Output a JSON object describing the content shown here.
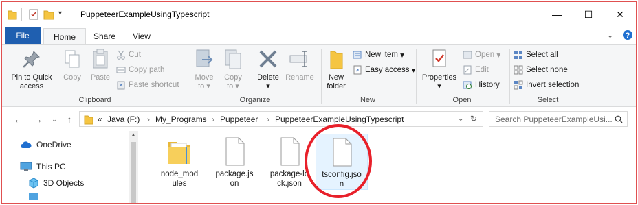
{
  "window": {
    "title": "PuppeteerExampleUsingTypescript",
    "minimize": "—",
    "maximize": "☐",
    "close": "✕"
  },
  "ribbon_tabs": {
    "file": "File",
    "home": "Home",
    "share": "Share",
    "view": "View"
  },
  "clipboard": {
    "pin": "Pin to Quick access",
    "pin_line1": "Pin to Quick",
    "pin_line2": "access",
    "copy": "Copy",
    "paste": "Paste",
    "cut": "Cut",
    "copy_path": "Copy path",
    "paste_shortcut": "Paste shortcut",
    "label": "Clipboard"
  },
  "organize": {
    "move_to": "Move to",
    "move_line1": "Move",
    "move_line2": "to",
    "copy_to": "Copy to",
    "copy_line1": "Copy",
    "copy_line2": "to",
    "delete": "Delete",
    "rename": "Rename",
    "label": "Organize"
  },
  "new": {
    "new_folder_line1": "New",
    "new_folder_line2": "folder",
    "new_item": "New item",
    "easy_access": "Easy access",
    "label": "New"
  },
  "open": {
    "properties": "Properties",
    "open": "Open",
    "edit": "Edit",
    "history": "History",
    "label": "Open"
  },
  "select": {
    "select_all": "Select all",
    "select_none": "Select none",
    "invert": "Invert selection",
    "label": "Select"
  },
  "address": {
    "prefix": "«",
    "crumbs": [
      "Java (F:)",
      "My_Programs",
      "Puppeteer",
      "PuppeteerExampleUsingTypescript"
    ],
    "search_placeholder": "Search PuppeteerExampleUsi..."
  },
  "nav_pane": {
    "items": [
      "OneDrive",
      "This PC",
      "3D Objects"
    ]
  },
  "files": [
    {
      "name": "node_modules",
      "line1": "node_mod",
      "line2": "ules",
      "type": "folder",
      "selected": false
    },
    {
      "name": "package.json",
      "line1": "package.js",
      "line2": "on",
      "type": "file",
      "selected": false
    },
    {
      "name": "package-lock.json",
      "line1": "package-lo",
      "line2": "ck.json",
      "type": "file",
      "selected": false
    },
    {
      "name": "tsconfig.json",
      "line1": "tsconfig.jso",
      "line2": "n",
      "type": "file",
      "selected": true
    }
  ],
  "colors": {
    "accent": "#1f5fb0",
    "highlight_circle": "#e8202a",
    "frame_border": "#e05050",
    "selection": "#e5f3ff"
  }
}
